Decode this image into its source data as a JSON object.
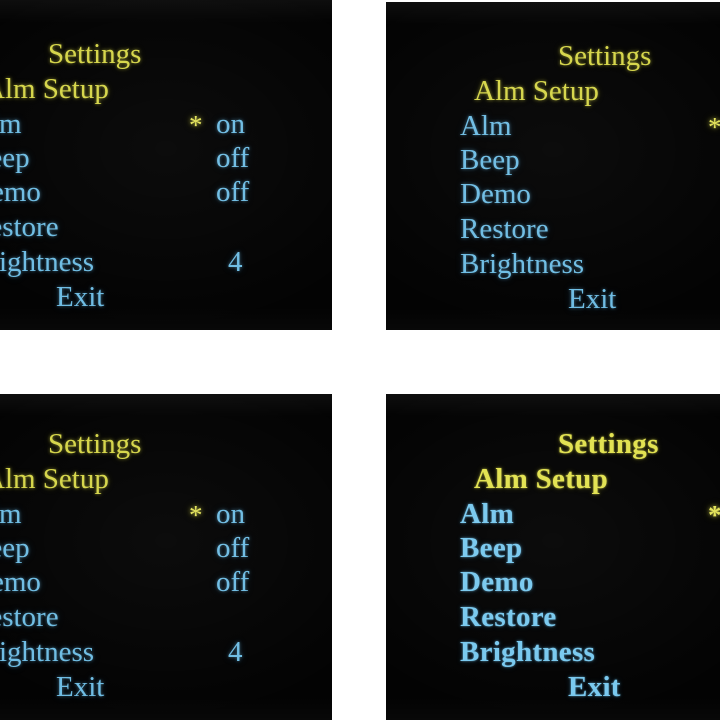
{
  "screen": {
    "title": "Settings",
    "subtitle": "Alm Setup",
    "exit_label": "Exit",
    "selected_marker": "*",
    "colors": {
      "background": "#030303",
      "heading": "#d6d64a",
      "item": "#6fbde4",
      "marker": "#e4e45a",
      "page_background": "#ffffff"
    },
    "menu": [
      {
        "label": "Alm",
        "value": "on",
        "marked": true
      },
      {
        "label": "Beep",
        "value": "off",
        "marked": false
      },
      {
        "label": "Demo",
        "value": "off",
        "marked": false
      },
      {
        "label": "Restore",
        "value": "",
        "marked": false
      },
      {
        "label": "Brightness",
        "value": "4",
        "marked": false
      }
    ]
  },
  "panels": [
    {
      "name": "top-left",
      "crop": "right-portion",
      "visible_text": "Settings / m Setup / * on / off / off / tore / ghtness 4 / Exit"
    },
    {
      "name": "top-right",
      "crop": "left-portion",
      "visible_text": "Settings / Alm Setup / Alm / Beep / Demo / Restore / Brightness / Exit / *"
    },
    {
      "name": "bottom-left",
      "crop": "right-portion",
      "visible_text": "Settings / m Setup / * on / off / off / tore / ghtness 4 / Exit"
    },
    {
      "name": "bottom-right",
      "crop": "left-portion",
      "visible_text": "Settings / Alm Setup / Alm / Beep / Demo / Restore / Brightness / Exit"
    }
  ]
}
